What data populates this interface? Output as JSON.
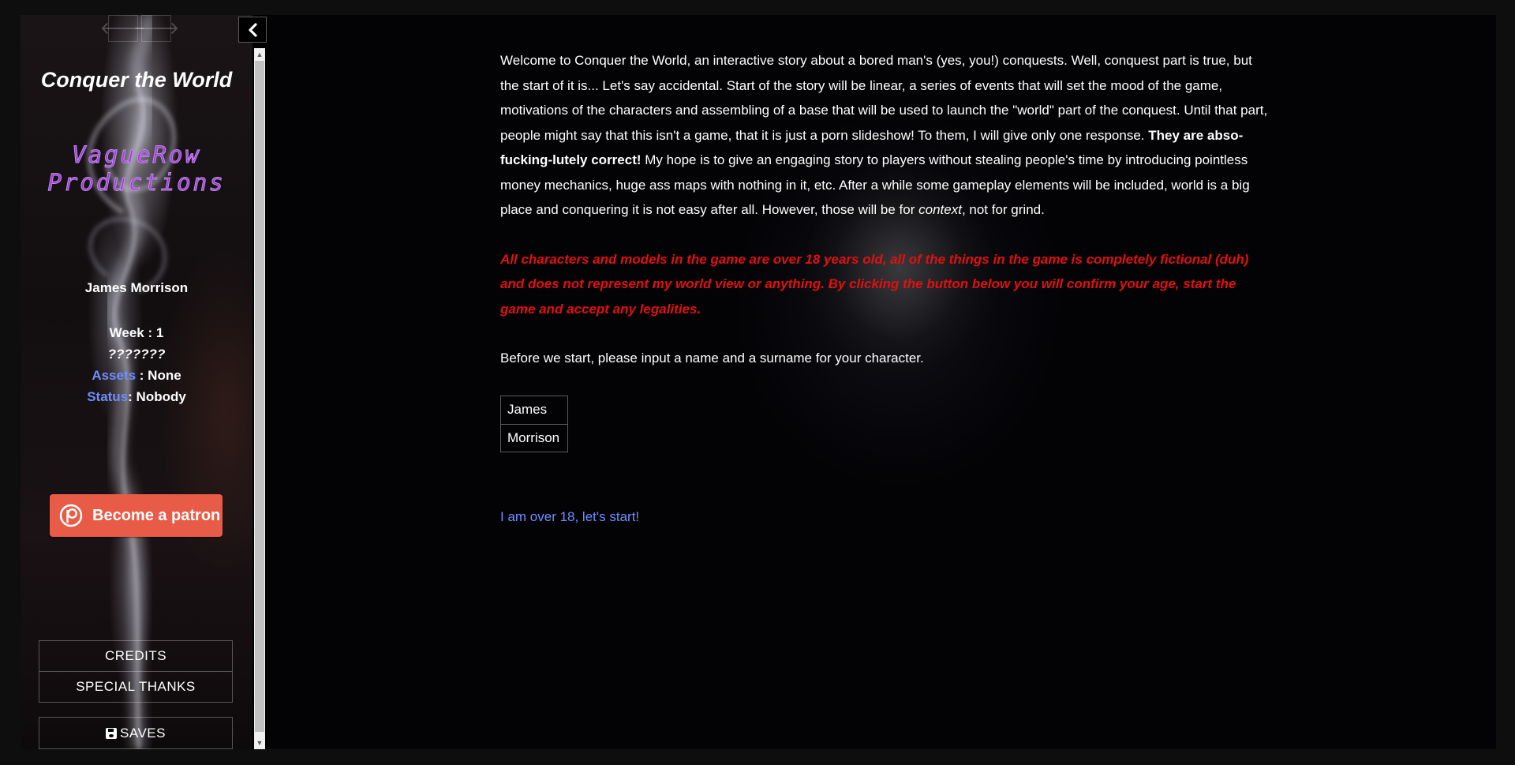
{
  "sidebar": {
    "back_arrow": "🡐",
    "forward_arrow": "🡒",
    "story_title": "Conquer the World",
    "studio_line1": "VagueRow",
    "studio_line2": "Productions",
    "player_name": "James Morrison",
    "week": "Week : 1",
    "day_unknown": "???????",
    "assets_label": "Assets",
    "assets_value": " : None",
    "status_label": "Status",
    "status_value": ": Nobody",
    "patron_label": "Become a patron",
    "menu": [
      "CREDITS",
      "SPECIAL THANKS"
    ],
    "saves_label": "SAVES"
  },
  "main": {
    "intro_before_bold": "Welcome to Conquer the World, an interactive story about a bored man's (yes, you!) conquests. Well, conquest part is true, but the start of it is... Let's say accidental. Start of the story will be linear, a series of events that will set the mood of the game, motivations of the characters and assembling of a base that will be used to launch the \"world\" part of the conquest. Until that part, people might say that this isn't a game, that it is just a porn slideshow! To them, I will give only one response. ",
    "intro_bold": "They are abso-fucking-lutely correct!",
    "intro_after_bold": " My hope is to give an engaging story to players without stealing people's time by introducing pointless money mechanics, huge ass maps with nothing in it, etc. After a while some gameplay elements will be included, world is a big place and conquering it is not easy after all. However, those will be for ",
    "intro_italic": "context",
    "intro_end": ", not for grind.",
    "warning": "All characters and models in the game are over 18 years old, all of the things in the game is completely fictional (duh) and does not represent my world view or anything. By clicking the button below you will confirm your age, start the game and accept any legalities.",
    "prompt": "Before we start, please input a name and a surname for your character.",
    "first_name": "James",
    "last_name": "Morrison",
    "start_link": "I am over 18, let's start!"
  },
  "colors": {
    "accent_link": "#6f8dff",
    "warning": "#e01010",
    "studio": "#9b3fd0",
    "patron": "#e85b46"
  }
}
